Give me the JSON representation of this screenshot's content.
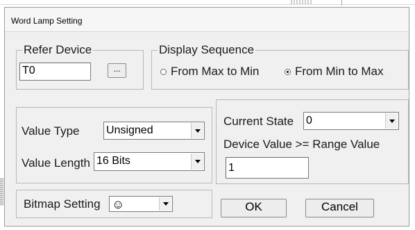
{
  "window": {
    "title": "Word Lamp Setting"
  },
  "refer_device": {
    "legend": "Refer Device",
    "value": "T0",
    "browse_label": "..."
  },
  "display_sequence": {
    "legend": "Display Sequence",
    "options": [
      {
        "label": "From Max to Min",
        "checked": false
      },
      {
        "label": "From Min to Max",
        "checked": true
      }
    ]
  },
  "value_group": {
    "type_label": "Value Type",
    "type_value": "Unsigned",
    "length_label": "Value Length",
    "length_value": "16 Bits"
  },
  "state_group": {
    "current_state_label": "Current State",
    "current_state_value": "0",
    "device_value_label": "Device Value >= Range Value",
    "device_value": "1"
  },
  "bitmap": {
    "label": "Bitmap Setting",
    "icon": "smiley-icon",
    "glyph": "☺"
  },
  "buttons": {
    "ok": "OK",
    "cancel": "Cancel"
  }
}
